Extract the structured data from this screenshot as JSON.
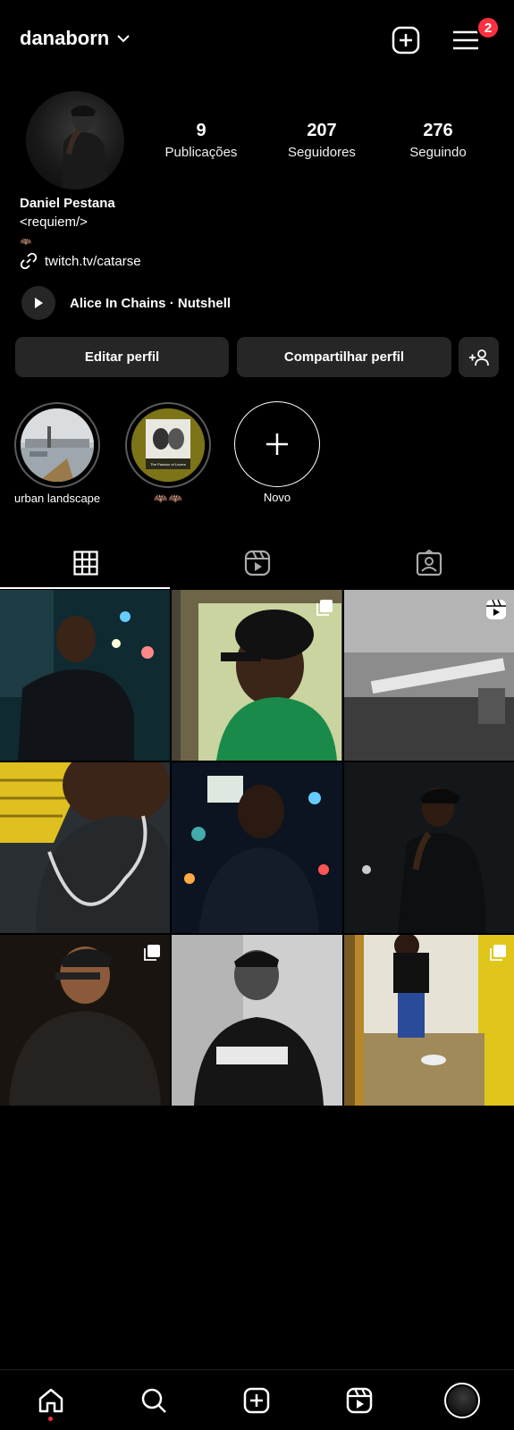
{
  "header": {
    "username": "danaborn",
    "notification_count": "2"
  },
  "profile": {
    "stats": [
      {
        "value": "9",
        "label": "Publicações"
      },
      {
        "value": "207",
        "label": "Seguidores"
      },
      {
        "value": "276",
        "label": "Seguindo"
      }
    ],
    "name": "Daniel Pestana",
    "bio": "<requiem/>",
    "bio_emoji": "🦇",
    "link": "twitch.tv/catarse",
    "music": "Alice In Chains · Nutshell"
  },
  "buttons": {
    "edit": "Editar perfil",
    "share": "Compartilhar perfil"
  },
  "highlights": [
    {
      "label": "urban landscape"
    },
    {
      "label": "🦇🦇",
      "cover_title": "The Passion of Lovers"
    },
    {
      "label": "Novo"
    }
  ],
  "tabs": [
    "grid-icon",
    "reels-icon",
    "tagged-icon"
  ],
  "posts": [
    {
      "type": "photo"
    },
    {
      "type": "carousel"
    },
    {
      "type": "reel"
    },
    {
      "type": "photo"
    },
    {
      "type": "photo"
    },
    {
      "type": "photo"
    },
    {
      "type": "carousel"
    },
    {
      "type": "photo"
    },
    {
      "type": "carousel"
    }
  ],
  "bottom_nav": [
    "home-icon",
    "search-icon",
    "create-icon",
    "reels-icon",
    "profile-avatar"
  ],
  "colors": {
    "background": "#000000",
    "button": "#262626",
    "badge": "#ff3040"
  }
}
